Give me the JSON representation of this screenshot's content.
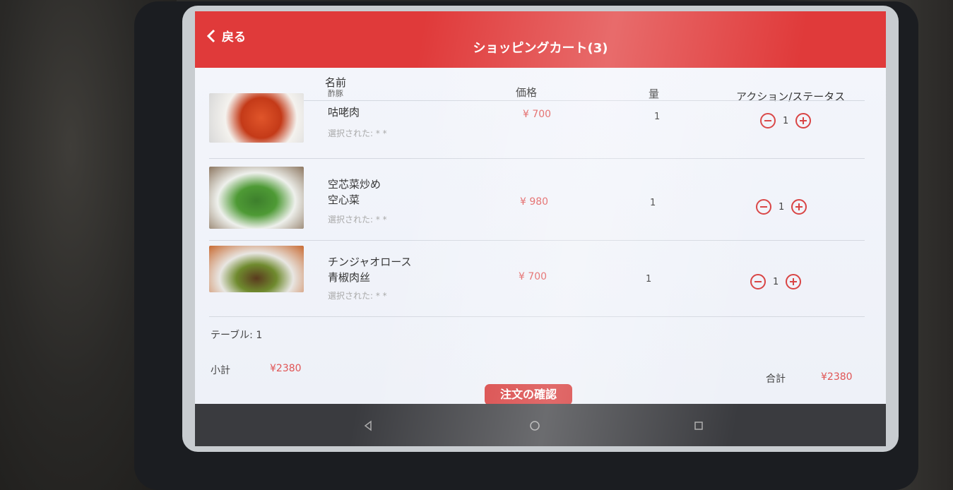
{
  "header": {
    "back_label": "戻る",
    "title": "ショッピングカート(3)"
  },
  "columns": {
    "name": "名前",
    "price": "価格",
    "quantity": "量",
    "action": "アクション/ステータス"
  },
  "items": [
    {
      "name1": "酢豚",
      "name2": "咕咾肉",
      "selected": "選択された: * *",
      "price": "¥ 700",
      "qty": "1",
      "stepper": "1"
    },
    {
      "name1": "空芯菜炒め",
      "name2": "空心菜",
      "selected": "選択された: * *",
      "price": "¥ 980",
      "qty": "1",
      "stepper": "1"
    },
    {
      "name1": "チンジャオロース",
      "name2": "青椒肉丝",
      "selected": "選択された: * *",
      "price": "¥ 700",
      "qty": "1",
      "stepper": "1"
    }
  ],
  "footer": {
    "table_label": "テーブル: 1",
    "subtotal_label": "小計",
    "subtotal_value": "¥2380",
    "total_label": "合計",
    "total_value": "¥2380",
    "confirm_label": "注文の確認"
  },
  "colors": {
    "accent": "#e03a3a",
    "price": "#e05555"
  },
  "icons": {
    "back": "chevron-left-icon",
    "minus": "minus-circle-icon",
    "plus": "plus-circle-icon",
    "nav_back": "triangle-back-icon",
    "nav_home": "circle-home-icon",
    "nav_recent": "square-recent-icon"
  }
}
